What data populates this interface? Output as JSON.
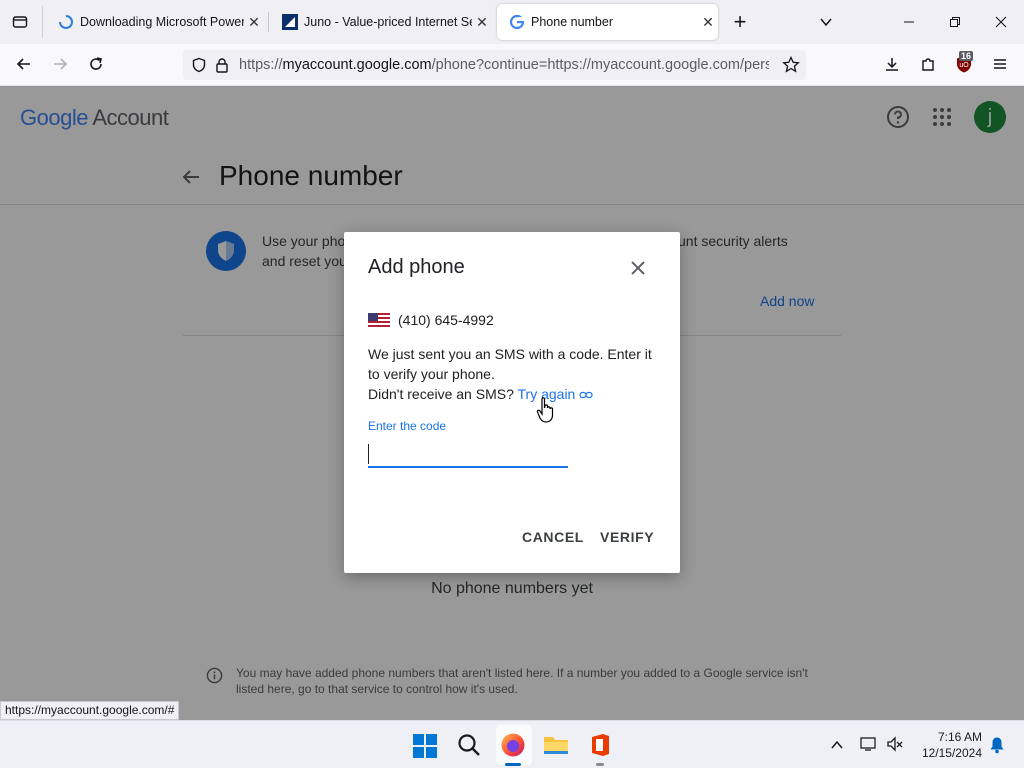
{
  "browser": {
    "tabs": [
      {
        "title": "Downloading Microsoft PowerP",
        "icon": "loading-spinner-icon"
      },
      {
        "title": "Juno - Value-priced Internet Ser",
        "icon": "juno-icon"
      },
      {
        "title": "Phone number",
        "icon": "google-g-icon",
        "active": true
      }
    ],
    "url_prefix": "https://",
    "url_host": "myaccount.google.com",
    "url_rest": "/phone?continue=https://myaccount.google.com/person",
    "extension_badge": "16",
    "status_url": "https://myaccount.google.com/#"
  },
  "page": {
    "logo_google": "Google",
    "logo_account": "Account",
    "avatar_letter": "j",
    "title": "Phone number",
    "info_left_line1": "Use your pho",
    "info_left_line2": "and reset you",
    "info_right": "unt security alerts",
    "add_now": "Add now",
    "no_numbers": "No phone numbers yet",
    "footer_note": "You may have added phone numbers that aren't listed here. If a number you added to a Google service isn't listed here, go to that service to control how it's used."
  },
  "dialog": {
    "title": "Add phone",
    "phone": "(410) 645-4992",
    "message": "We just sent you an SMS with a code. Enter it to verify your phone.",
    "didnt_receive": "Didn't receive an SMS?",
    "try_again": "Try again",
    "code_label": "Enter the code",
    "code_value": "",
    "cancel": "CANCEL",
    "verify": "VERIFY"
  },
  "taskbar": {
    "time": "7:16 AM",
    "date": "12/15/2024"
  },
  "colors": {
    "accent": "#1a73e8",
    "avatar": "#1e8e3e"
  }
}
